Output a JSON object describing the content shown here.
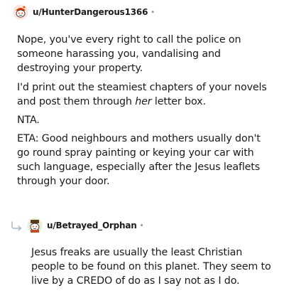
{
  "comment1": {
    "username": "u/HunterDangerous1366",
    "separator": "•",
    "paragraphs": [
      "Nope, you've every right to call the police on someone harassing you, vandalising and destroying your property.",
      {
        "before": "I'd print out the steamiest chapters of your novels and post them through ",
        "emphasis": "her",
        "after": " letter box."
      },
      "NTA.",
      "ETA: Good neighbours and mothers usually don't go round spray painting or keying your car with such language, especially after the Jesus leaflets through your door."
    ]
  },
  "reply": {
    "username": "u/Betrayed_Orphan",
    "separator": "•",
    "paragraphs": [
      "Jesus freaks are usually the least Christian people to be found on this planet. They seem to live by a CREDO of do as I say not as I do."
    ]
  },
  "icons": {
    "avatar1": "snoo-avatar-icon",
    "avatar2": "snoo-avatar-icon",
    "reply": "reply-arrow-icon"
  },
  "colors": {
    "text": "#1a1a1b",
    "meta": "#878a8c",
    "avatar_orange": "#ff4500"
  }
}
